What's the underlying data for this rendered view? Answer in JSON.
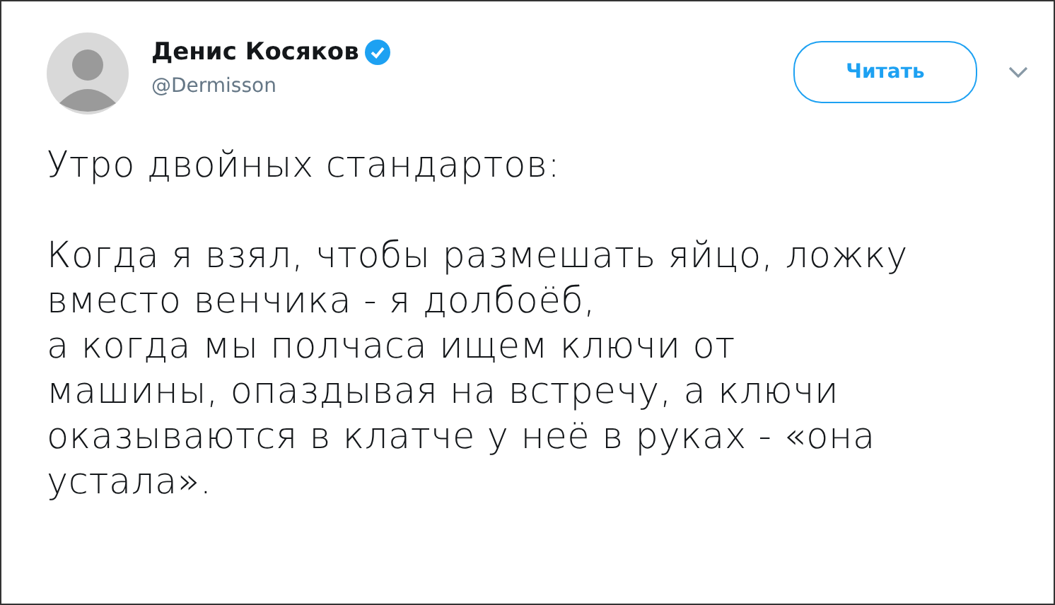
{
  "author": {
    "name": "Денис Косяков",
    "verified": true,
    "handle": "@Dermisson"
  },
  "follow_button": {
    "label": "Читать"
  },
  "tweet": {
    "paragraphs": [
      [
        "Утро двойных стандартов:"
      ],
      [
        "Когда я взял, чтобы размешать яйцо, ложку",
        "вместо венчика - я долбоёб,",
        "а когда мы полчаса ищем ключи от",
        "машины, опаздывая на встречу, а ключи",
        "оказываются в клатче у неё в руках - «она",
        "устала»."
      ]
    ]
  }
}
